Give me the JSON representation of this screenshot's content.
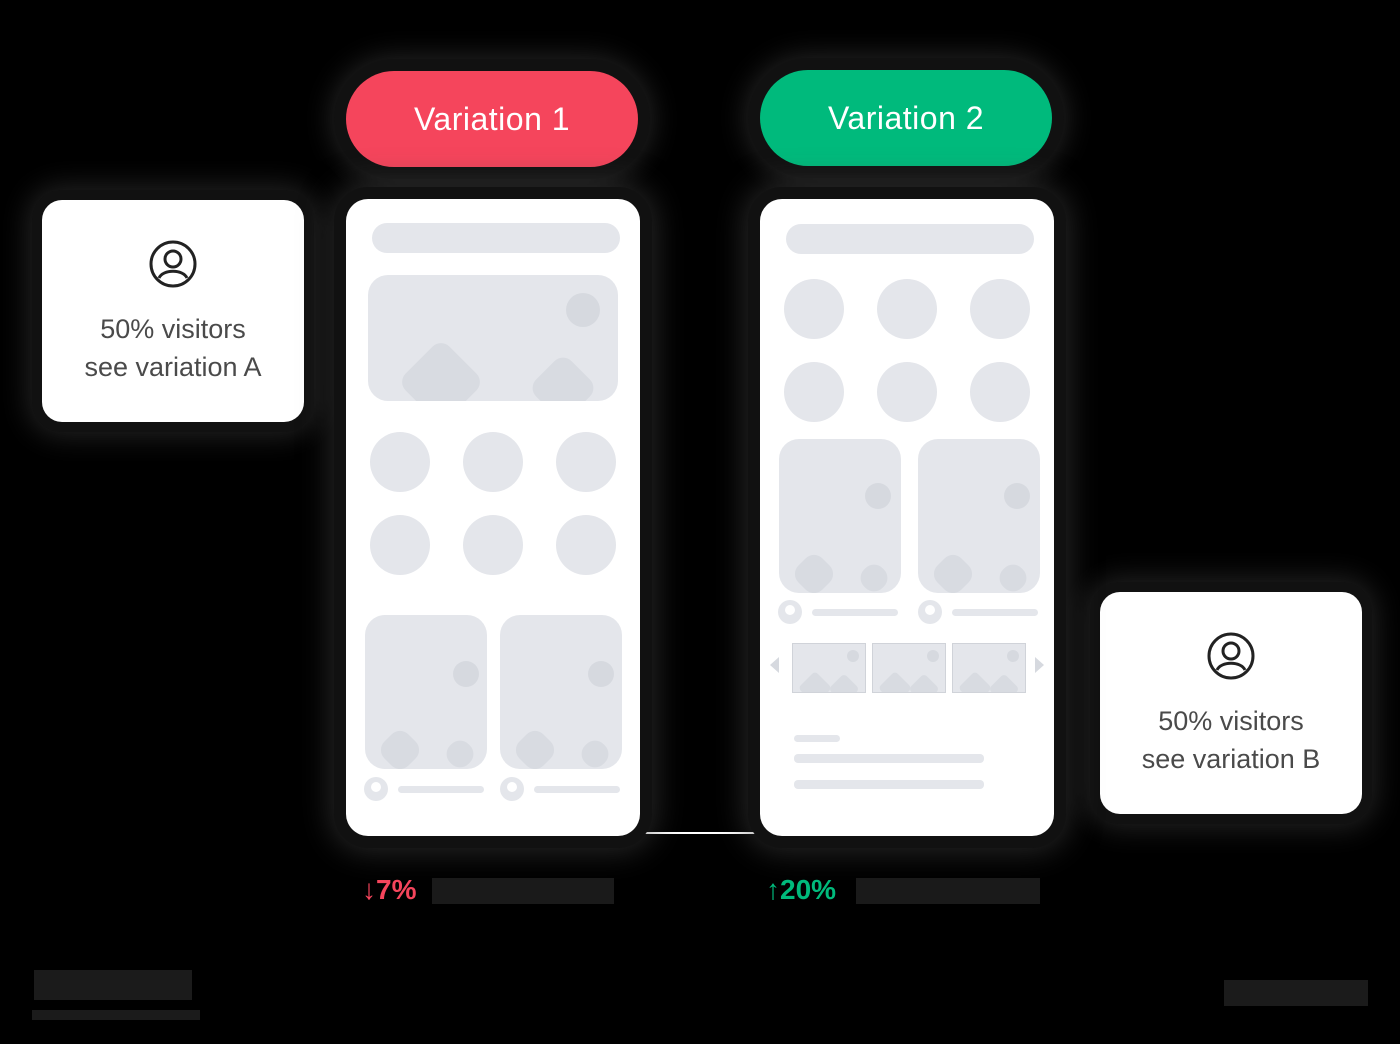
{
  "variations": {
    "v1": {
      "label": "Variation 1",
      "color": "#F5455C",
      "change": "7%",
      "direction": "down"
    },
    "v2": {
      "label": "Variation 2",
      "color": "#00BA7C",
      "change": "20%",
      "direction": "up"
    }
  },
  "cards": {
    "a": {
      "icon": "user-icon",
      "line1": "50% visitors",
      "line2": "see variation A"
    },
    "b": {
      "icon": "user-icon",
      "line1": "50% visitors",
      "line2": "see variation B"
    }
  },
  "colors": {
    "placeholder": "#E4E6EB",
    "card_text": "#4a4a4a",
    "background": "#000000"
  }
}
